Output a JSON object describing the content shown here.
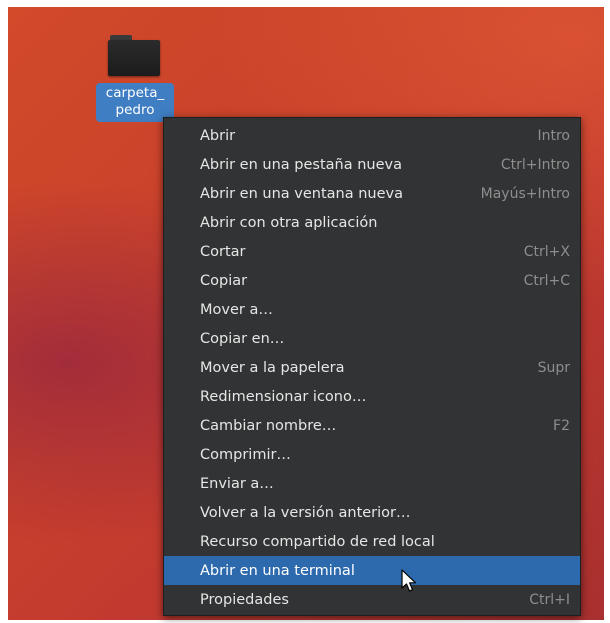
{
  "desktop": {
    "icon": {
      "label": "carpeta_\npedro",
      "label_line1": "carpeta_",
      "label_line2": "pedro",
      "icon": "folder-icon"
    }
  },
  "context_menu": {
    "items": [
      {
        "label": "Abrir",
        "shortcut": "Intro"
      },
      {
        "label": "Abrir en una pestaña nueva",
        "shortcut": "Ctrl+Intro"
      },
      {
        "label": "Abrir en una ventana nueva",
        "shortcut": "Mayús+Intro"
      },
      {
        "label": "Abrir con otra aplicación",
        "shortcut": ""
      },
      {
        "label": "Cortar",
        "shortcut": "Ctrl+X"
      },
      {
        "label": "Copiar",
        "shortcut": "Ctrl+C"
      },
      {
        "label": "Mover a…",
        "shortcut": ""
      },
      {
        "label": "Copiar en…",
        "shortcut": ""
      },
      {
        "label": "Mover a la papelera",
        "shortcut": "Supr"
      },
      {
        "label": "Redimensionar icono…",
        "shortcut": ""
      },
      {
        "label": "Cambiar nombre…",
        "shortcut": "F2"
      },
      {
        "label": "Comprimir…",
        "shortcut": ""
      },
      {
        "label": "Enviar a…",
        "shortcut": ""
      },
      {
        "label": "Volver a la versión anterior…",
        "shortcut": ""
      },
      {
        "label": "Recurso compartido de red local",
        "shortcut": ""
      },
      {
        "label": "Abrir en una terminal",
        "shortcut": "",
        "highlighted": true
      },
      {
        "label": "Propiedades",
        "shortcut": "Ctrl+I"
      }
    ]
  },
  "colors": {
    "menu_background": "#323334",
    "highlight": "#2d69ad",
    "selection_label": "#3f7ec3",
    "desktop_accent": "#c9412b"
  },
  "cursor": {
    "icon": "arrow-cursor-icon"
  }
}
